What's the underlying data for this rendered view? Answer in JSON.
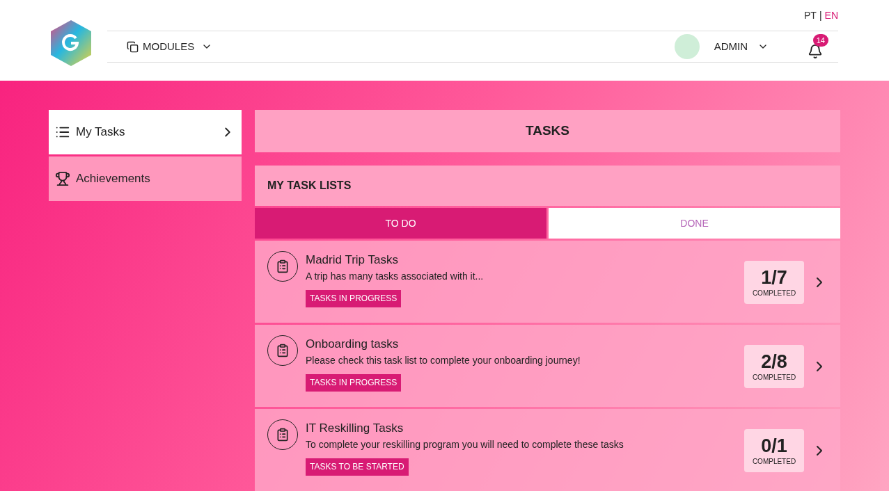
{
  "languages": [
    {
      "label": "PT",
      "selected": false
    },
    {
      "label": "EN",
      "selected": true
    }
  ],
  "language_separator": "|",
  "nav": {
    "modules": "MODULES",
    "user": "ADMIN",
    "notifications": "14"
  },
  "sidebar": {
    "items": [
      {
        "label": "My Tasks",
        "kind": "list",
        "selected": true
      },
      {
        "label": "Achievements",
        "kind": "trophy",
        "selected": false
      }
    ]
  },
  "page_title": "TASKS",
  "section_title": "MY TASK LISTS",
  "tabs": [
    {
      "label": "TO DO",
      "selected": true
    },
    {
      "label": "DONE",
      "selected": false
    }
  ],
  "task_lists": [
    {
      "title": "Madrid Trip Tasks",
      "description": "A trip has many tasks associated with it...",
      "status": "TASKS IN PROGRESS",
      "count": "1/7",
      "count_label": "COMPLETED"
    },
    {
      "title": "Onboarding tasks",
      "description": "Please check this task list to complete your onboarding journey!",
      "status": "TASKS IN PROGRESS",
      "count": "2/8",
      "count_label": "COMPLETED"
    },
    {
      "title": "IT Reskilling Tasks",
      "description": "To complete your reskilling program you will need to complete these tasks",
      "status": "TASKS TO BE STARTED",
      "count": "0/1",
      "count_label": "COMPLETED"
    }
  ]
}
